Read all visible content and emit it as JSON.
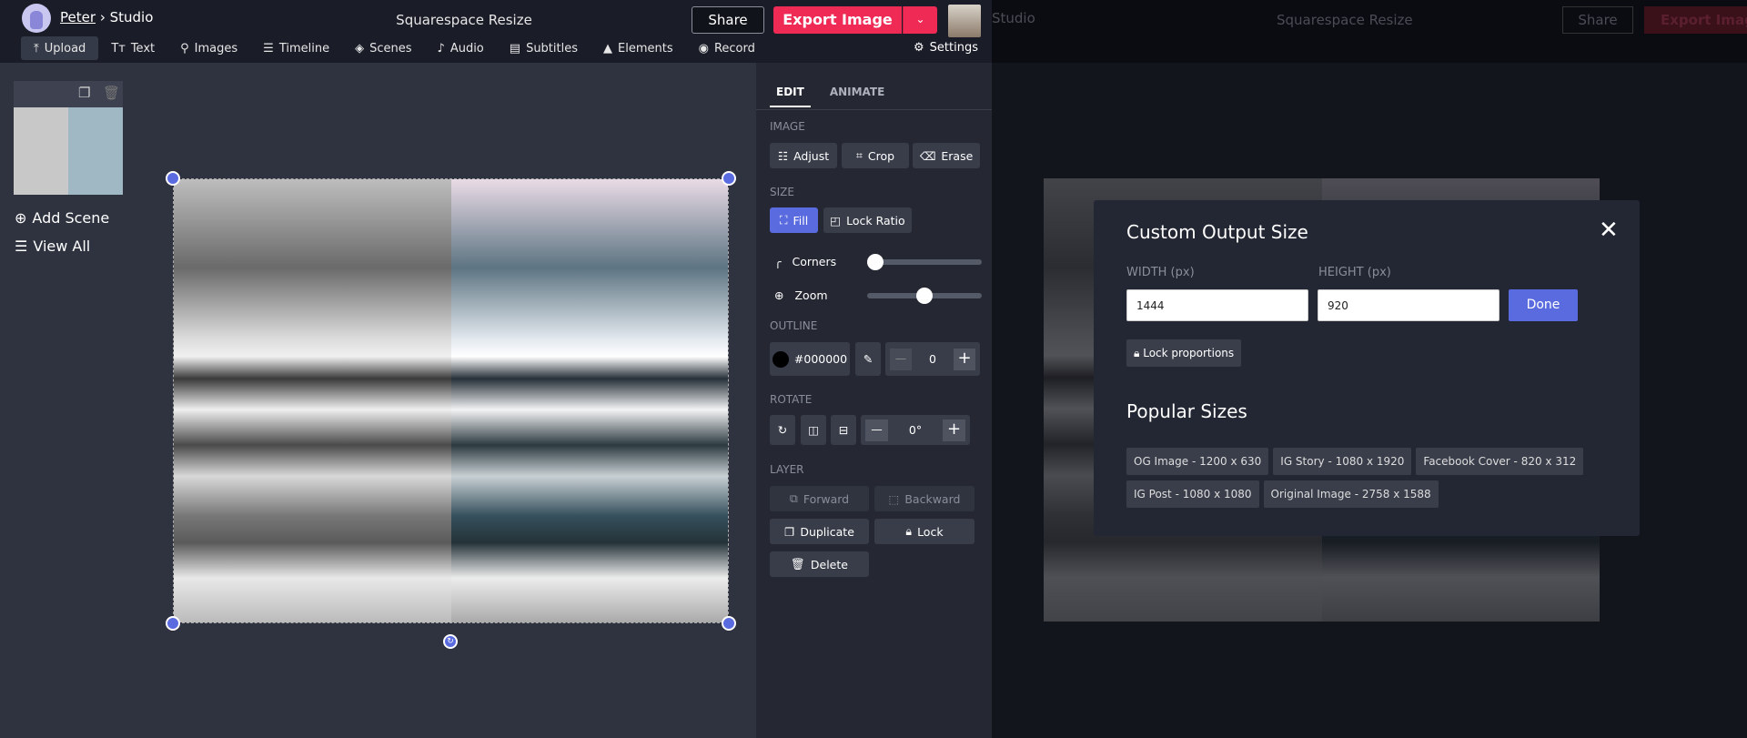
{
  "header": {
    "user": "Peter",
    "separator": "›",
    "section": "Studio",
    "project_title": "Squarespace Resize",
    "share": "Share",
    "export": "Export Image"
  },
  "toolbar": [
    {
      "label": "Upload",
      "icon": "upload-icon",
      "glyph": "⤒"
    },
    {
      "label": "Text",
      "icon": "text-icon",
      "glyph": "Tт"
    },
    {
      "label": "Images",
      "icon": "search-icon",
      "glyph": "⚲"
    },
    {
      "label": "Timeline",
      "icon": "timeline-icon",
      "glyph": "☰"
    },
    {
      "label": "Scenes",
      "icon": "layers-icon",
      "glyph": "◈"
    },
    {
      "label": "Audio",
      "icon": "music-note-icon",
      "glyph": "♪"
    },
    {
      "label": "Subtitles",
      "icon": "subtitles-icon",
      "glyph": "▤"
    },
    {
      "label": "Elements",
      "icon": "shapes-icon",
      "glyph": "▲"
    },
    {
      "label": "Record",
      "icon": "record-icon",
      "glyph": "◉"
    }
  ],
  "settings": "Settings",
  "scenes": {
    "add": "Add Scene",
    "view_all": "View All"
  },
  "panel": {
    "tabs": [
      "EDIT",
      "ANIMATE"
    ],
    "image_label": "IMAGE",
    "adjust": "Adjust",
    "crop": "Crop",
    "erase": "Erase",
    "size_label": "SIZE",
    "fill": "Fill",
    "lock_ratio": "Lock Ratio",
    "corners": "Corners",
    "zoom": "Zoom",
    "corners_value": 0,
    "zoom_value": 0.5,
    "outline_label": "OUTLINE",
    "outline_color": "#000000",
    "outline_width": "0",
    "rotate_label": "ROTATE",
    "rotate_value": "0°",
    "layer_label": "LAYER",
    "forward": "Forward",
    "backward": "Backward",
    "duplicate": "Duplicate",
    "lock": "Lock",
    "delete": "Delete"
  },
  "modal": {
    "title": "Custom Output Size",
    "width_label": "WIDTH (px)",
    "height_label": "HEIGHT (px)",
    "width_value": "1444",
    "height_value": "920",
    "done": "Done",
    "lock_proportions": "Lock proportions",
    "popular_title": "Popular Sizes",
    "sizes": [
      "OG Image - 1200 x 630",
      "IG Story - 1080 x 1920",
      "Facebook Cover - 820 x 312",
      "IG Post - 1080 x 1080",
      "Original Image - 2758 x 1588"
    ]
  },
  "colors": {
    "accent": "#5a6be0",
    "export": "#ee2a55"
  }
}
